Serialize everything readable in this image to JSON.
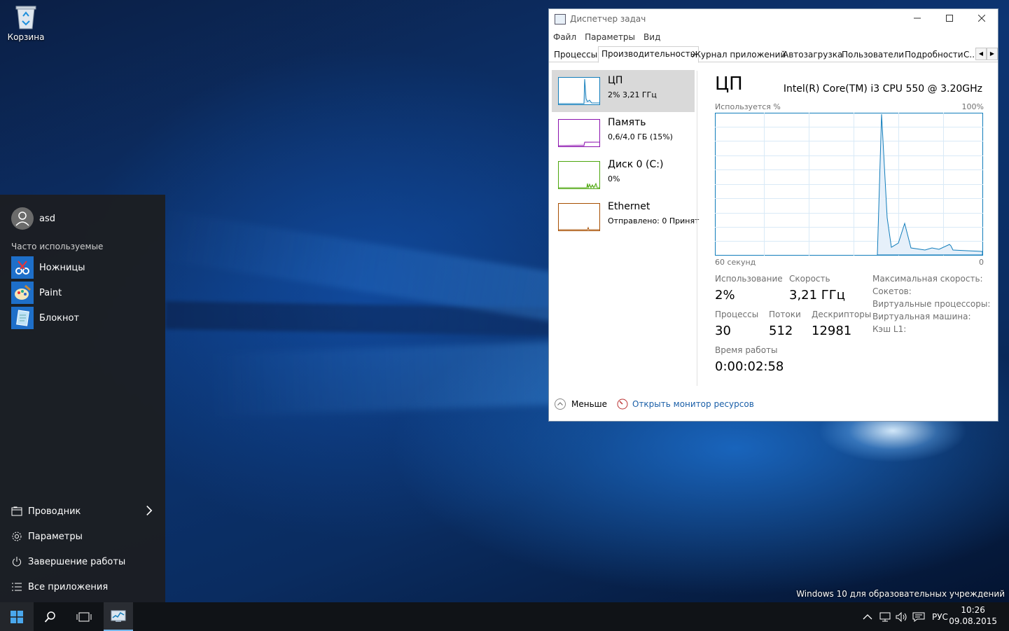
{
  "desktop": {
    "recycle_bin_label": "Корзина",
    "watermark": "Windows 10 для образовательных учреждений"
  },
  "start_menu": {
    "user_name": "asd",
    "frequent_title": "Часто используемые",
    "apps": [
      {
        "label": "Ножницы",
        "icon": "scissors-icon"
      },
      {
        "label": "Paint",
        "icon": "paint-icon"
      },
      {
        "label": "Блокнот",
        "icon": "notepad-icon"
      }
    ],
    "bottom": [
      {
        "label": "Проводник",
        "icon": "file-explorer-icon"
      },
      {
        "label": "Параметры",
        "icon": "gear-icon"
      },
      {
        "label": "Завершение работы",
        "icon": "power-icon"
      },
      {
        "label": "Все приложения",
        "icon": "all-apps-icon"
      }
    ]
  },
  "task_manager": {
    "title": "Диспетчер задач",
    "menu": [
      "Файл",
      "Параметры",
      "Вид"
    ],
    "tabs": [
      "Процессы",
      "Производительность",
      "Журнал приложений",
      "Автозагрузка",
      "Пользователи",
      "Подробности",
      "С..."
    ],
    "active_tab": "Производительность",
    "resources": [
      {
        "name": "ЦП",
        "sub": "2% 3,21 ГГц",
        "color": "#117dbb"
      },
      {
        "name": "Память",
        "sub": "0,6/4,0 ГБ (15%)",
        "color": "#8b12ae"
      },
      {
        "name": "Диск 0 (C:)",
        "sub": "0%",
        "color": "#4da60c"
      },
      {
        "name": "Ethernet",
        "sub": "Отправлено: 0 Принят",
        "color": "#a74f01"
      }
    ],
    "detail": {
      "title": "ЦП",
      "cpu_model": "Intel(R) Core(TM) i3 CPU 550 @ 3.20GHz",
      "graph_label_top_left": "Используется %",
      "graph_label_top_right": "100%",
      "graph_label_bottom_left": "60 секунд",
      "graph_label_bottom_right": "0",
      "stats": {
        "usage_label": "Использование",
        "usage_value": "2%",
        "speed_label": "Скорость",
        "speed_value": "3,21 ГГц",
        "processes_label": "Процессы",
        "processes_value": "30",
        "threads_label": "Потоки",
        "threads_value": "512",
        "handles_label": "Дескрипторы",
        "handles_value": "12981",
        "uptime_label": "Время работы",
        "uptime_value": "0:00:02:58"
      },
      "right_labels": [
        "Максимальная скорость:",
        "Сокетов:",
        "Виртуальные процессоры:",
        "Виртуальная машина:",
        "Кэш L1:"
      ]
    },
    "footer": {
      "less": "Меньше",
      "resource_monitor": "Открыть монитор ресурсов"
    }
  },
  "taskbar": {
    "language": "РУС",
    "time": "10:26",
    "date": "09.08.2015"
  }
}
